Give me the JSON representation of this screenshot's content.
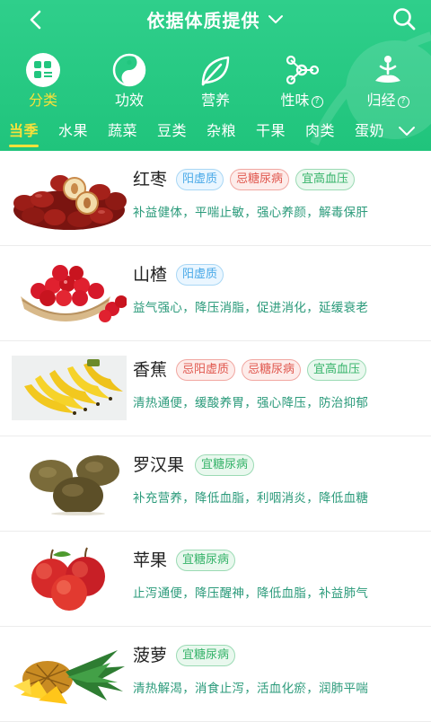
{
  "header": {
    "title": "依据体质提供",
    "colors": {
      "primary": "#21c57e",
      "active": "#f7e13b"
    },
    "icons": {
      "back": "back-arrow-icon",
      "title_toggle": "chevron-down-icon",
      "search": "search-icon"
    }
  },
  "categories": [
    {
      "label": "分类",
      "icon": "category-grid-icon",
      "active": true,
      "help": ""
    },
    {
      "label": "功效",
      "icon": "yin-yang-icon",
      "active": false,
      "help": ""
    },
    {
      "label": "营养",
      "icon": "leaf-icon",
      "active": false,
      "help": ""
    },
    {
      "label": "性味",
      "icon": "molecule-icon",
      "active": false,
      "help": "?"
    },
    {
      "label": "归经",
      "icon": "meditation-icon",
      "active": false,
      "help": "?"
    }
  ],
  "tabs": {
    "items": [
      "当季",
      "水果",
      "蔬菜",
      "豆类",
      "杂粮",
      "干果",
      "肉类",
      "蛋奶"
    ],
    "active_index": 0,
    "more_icon": "chevron-down-icon"
  },
  "foods": [
    {
      "name": "红枣",
      "image": "red-dates",
      "tags": [
        {
          "text": "阳虚质",
          "type": "blue"
        },
        {
          "text": "忌糖尿病",
          "type": "red"
        },
        {
          "text": "宜高血压",
          "type": "green"
        }
      ],
      "desc": "补益健体，平喘止敏，强心养颜，解毒保肝"
    },
    {
      "name": "山楂",
      "image": "hawthorn",
      "tags": [
        {
          "text": "阳虚质",
          "type": "blue"
        }
      ],
      "desc": "益气强心，降压消脂，促进消化，延缓衰老"
    },
    {
      "name": "香蕉",
      "image": "banana",
      "tags": [
        {
          "text": "忌阳虚质",
          "type": "red"
        },
        {
          "text": "忌糖尿病",
          "type": "red"
        },
        {
          "text": "宜高血压",
          "type": "green"
        }
      ],
      "desc": "清热通便，缓酸养胃，强心降压，防治抑郁"
    },
    {
      "name": "罗汉果",
      "image": "monk-fruit",
      "tags": [
        {
          "text": "宜糖尿病",
          "type": "green"
        }
      ],
      "desc": "补充营养，降低血脂，利咽消炎，降低血糖"
    },
    {
      "name": "苹果",
      "image": "apple",
      "tags": [
        {
          "text": "宜糖尿病",
          "type": "green"
        }
      ],
      "desc": "止泻通便，降压醒神，降低血脂，补益肺气"
    },
    {
      "name": "菠萝",
      "image": "pineapple",
      "tags": [
        {
          "text": "宜糖尿病",
          "type": "green"
        }
      ],
      "desc": "清热解渴，消食止泻，活血化瘀，润肺平喘"
    }
  ]
}
